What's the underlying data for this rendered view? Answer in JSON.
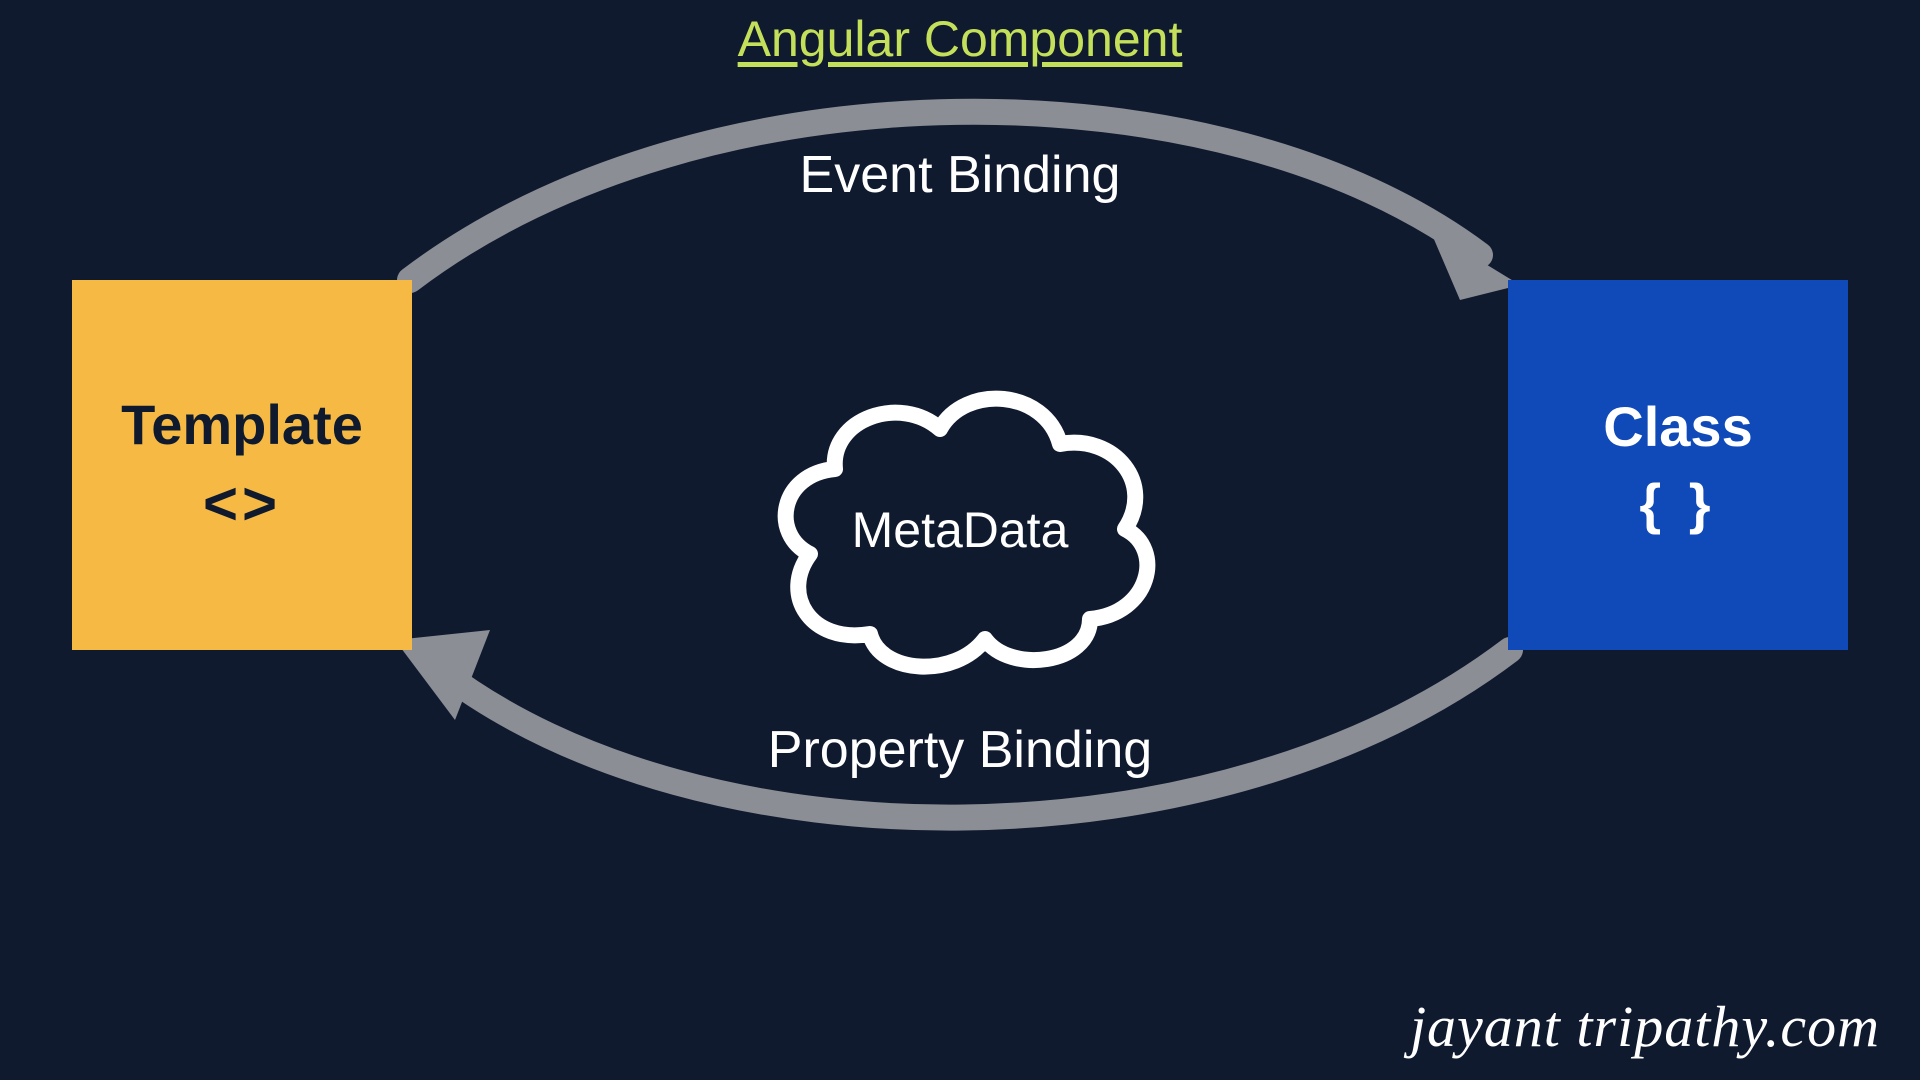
{
  "title": "Angular Component",
  "template_box": {
    "label": "Template",
    "symbol": "<>"
  },
  "class_box": {
    "label": "Class",
    "symbol": "{ }"
  },
  "metadata": {
    "label": "MetaData"
  },
  "bindings": {
    "event": "Event Binding",
    "property": "Property Binding"
  },
  "watermark": "jayant tripathy.com",
  "colors": {
    "bg": "#0f1a2e",
    "title": "#c4e05a",
    "template_bg": "#f5b944",
    "class_bg": "#1049b8",
    "arrow": "#8b8e94",
    "text_light": "#ffffff",
    "text_dark": "#0f1a2e"
  }
}
